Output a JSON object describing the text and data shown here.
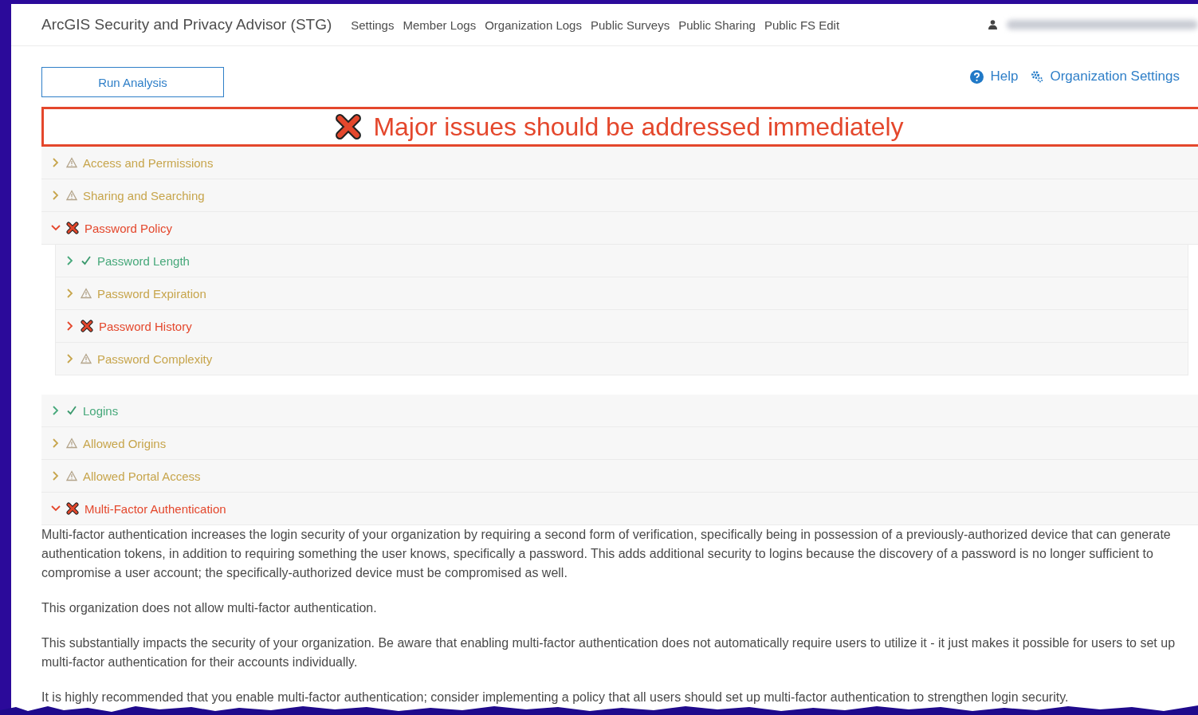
{
  "header": {
    "title": "ArcGIS Security and Privacy Advisor (STG)",
    "nav": [
      "Settings",
      "Member Logs",
      "Organization Logs",
      "Public Surveys",
      "Public Sharing",
      "Public FS Edit"
    ]
  },
  "toolbar": {
    "run_button": "Run Analysis",
    "links": [
      {
        "kind": "help",
        "label": "Help"
      },
      {
        "kind": "settings",
        "label": "Organization Settings"
      }
    ]
  },
  "banner": {
    "kind": "error",
    "message": "Major issues should be addressed immediately"
  },
  "sections": [
    {
      "label": "Access and Permissions",
      "kind": "warning",
      "expanded": false
    },
    {
      "label": "Sharing and Searching",
      "kind": "warning",
      "expanded": false
    },
    {
      "label": "Password Policy",
      "kind": "error",
      "expanded": true,
      "children": [
        {
          "label": "Password Length",
          "kind": "success",
          "expanded": false
        },
        {
          "label": "Password Expiration",
          "kind": "warning",
          "expanded": false
        },
        {
          "label": "Password History",
          "kind": "error",
          "expanded": false
        },
        {
          "label": "Password Complexity",
          "kind": "warning",
          "expanded": false
        }
      ]
    },
    {
      "label": "Logins",
      "kind": "success",
      "expanded": false
    },
    {
      "label": "Allowed Origins",
      "kind": "warning",
      "expanded": false
    },
    {
      "label": "Allowed Portal Access",
      "kind": "warning",
      "expanded": false
    },
    {
      "label": "Multi-Factor Authentication",
      "kind": "error",
      "expanded": true,
      "details": [
        "Multi-factor authentication increases the login security of your organization by requiring a second form of verification, specifically being in possession of a previously-authorized device that can generate authentication tokens, in addition to requiring something the user knows, specifically a password. This adds additional security to logins because the discovery of a password is no longer sufficient to compromise a user account; the specifically-authorized device must be compromised as well.",
        "This organization does not allow multi-factor authentication.",
        "This substantially impacts the security of your organization. Be aware that enabling multi-factor authentication does not automatically require users to utilize it - it just makes it possible for users to set up multi-factor authentication for their accounts individually.",
        "It is highly recommended that you enable multi-factor authentication; consider implementing a policy that all users should set up multi-factor authentication to strengthen login security."
      ]
    }
  ]
}
